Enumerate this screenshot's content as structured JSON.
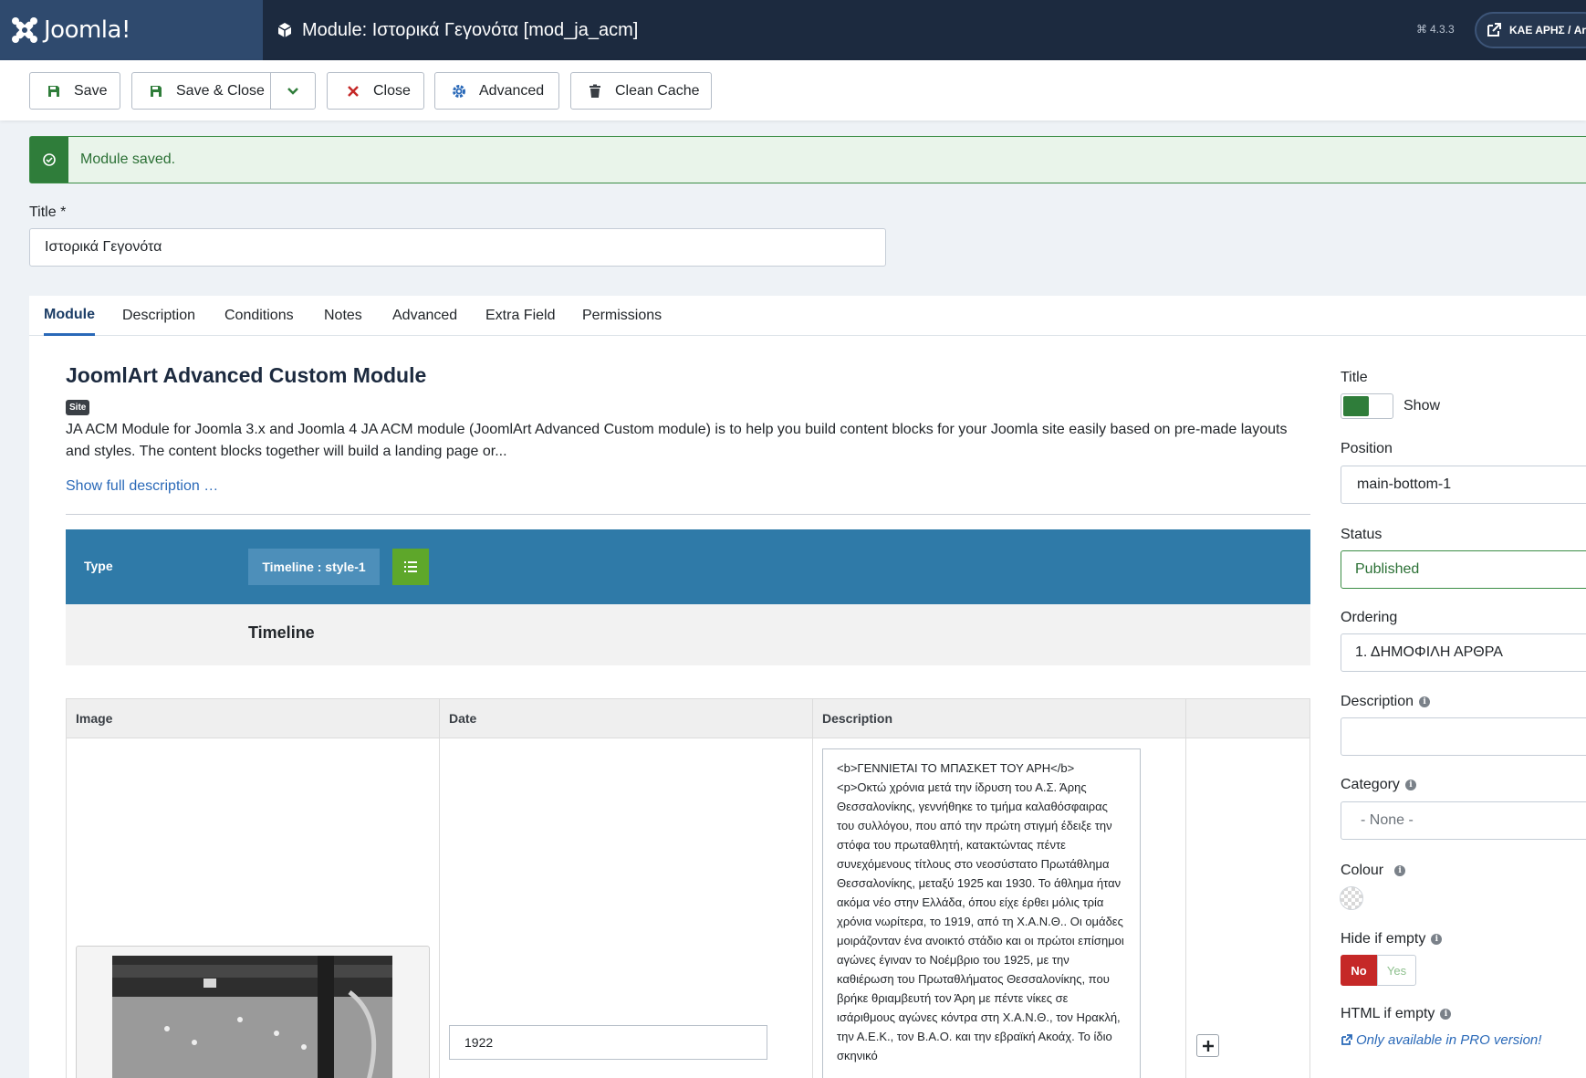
{
  "header": {
    "logo_text": "Joomla!",
    "page_title": "Module: Ιστορικά Γεγονότα [mod_ja_acm]",
    "version": "4.3.3",
    "site_name": "ΚΑΕ ΑΡΗΣ / Ari"
  },
  "toolbar": {
    "save_label": "Save",
    "save_close_label": "Save & Close",
    "close_label": "Close",
    "advanced_label": "Advanced",
    "clean_cache_label": "Clean Cache"
  },
  "alert": {
    "message": "Module saved."
  },
  "title_field": {
    "label": "Title *",
    "value": "Ιστορικά Γεγονότα"
  },
  "tabs": [
    {
      "label": "Module",
      "active": true
    },
    {
      "label": "Description"
    },
    {
      "label": "Conditions"
    },
    {
      "label": "Notes"
    },
    {
      "label": "Advanced"
    },
    {
      "label": "Extra Field"
    },
    {
      "label": "Permissions"
    }
  ],
  "module": {
    "heading": "JoomlArt Advanced Custom Module",
    "badge": "Site",
    "description": "JA ACM Module for Joomla 3.x and Joomla 4 JA ACM module (JoomlArt Advanced Custom module) is to help you build content blocks for your Joomla site easily based on pre-made layouts and styles. The content blocks together will build a landing page or...",
    "show_full": "Show full description …"
  },
  "type_bar": {
    "label": "Type",
    "selected": "Timeline : style-1",
    "section_title": "Timeline"
  },
  "table": {
    "columns": [
      "Image",
      "Date",
      "Description"
    ],
    "row": {
      "date": "1922",
      "description": "<b>ΓΕΝΝΙΕΤΑΙ ΤΟ ΜΠΑΣΚΕΤ ΤΟΥ ΑΡΗ</b>\n<p>Οκτώ χρόνια μετά την ίδρυση του Α.Σ. Άρης Θεσσαλονίκης, γεννήθηκε το τμήμα καλαθόσφαιρας του συλλόγου, που από την πρώτη στιγμή έδειξε την στόφα του πρωταθλητή, κατακτώντας πέντε συνεχόμενους τίτλους στο νεοσύστατο Πρωτάθλημα Θεσσαλονίκης, μεταξύ 1925 και 1930. Το άθλημα ήταν ακόμα νέο στην Ελλάδα, όπου είχε έρθει μόλις τρία χρόνια νωρίτερα, το 1919, από τη Χ.Α.Ν.Θ.. Οι ομάδες μοιράζονταν ένα ανοικτό στάδιο και οι πρώτοι επίσημοι αγώνες έγιναν το Νοέμβριο του 1925, με την καθιέρωση του Πρωταθλήματος Θεσσαλονίκης, που βρήκε θριαμβευτή τον Άρη με πέντε νίκες σε ισάριθμους αγώνες κόντρα στη Χ.Α.Ν.Θ., τον Ηρακλή, την Α.Ε.Κ., τον Β.Α.Ο. και την εβραϊκή Ακοάχ. Το ίδιο σκηνικό"
    }
  },
  "sidebar": {
    "title_label": "Title",
    "title_toggle": "Show",
    "position_label": "Position",
    "position_value": "main-bottom-1",
    "status_label": "Status",
    "status_value": "Published",
    "ordering_label": "Ordering",
    "ordering_value": "1. ΔΗΜΟΦΙΛΗ ΑΡΘΡΑ",
    "description_label": "Description",
    "description_value": "",
    "category_label": "Category",
    "category_value": "- None -",
    "colour_label": "Colour",
    "hide_if_empty_label": "Hide if empty",
    "no_label": "No",
    "yes_label": "Yes",
    "html_if_empty_label": "HTML if empty",
    "pro_link": "Only available in PRO version!"
  },
  "colors": {
    "header_bg": "#1c2a3f",
    "logo_bg": "#2f4a6e",
    "success": "#2f7d3a",
    "type_bar": "#2f7aa8",
    "danger": "#c52827",
    "link": "#2a69b8"
  }
}
